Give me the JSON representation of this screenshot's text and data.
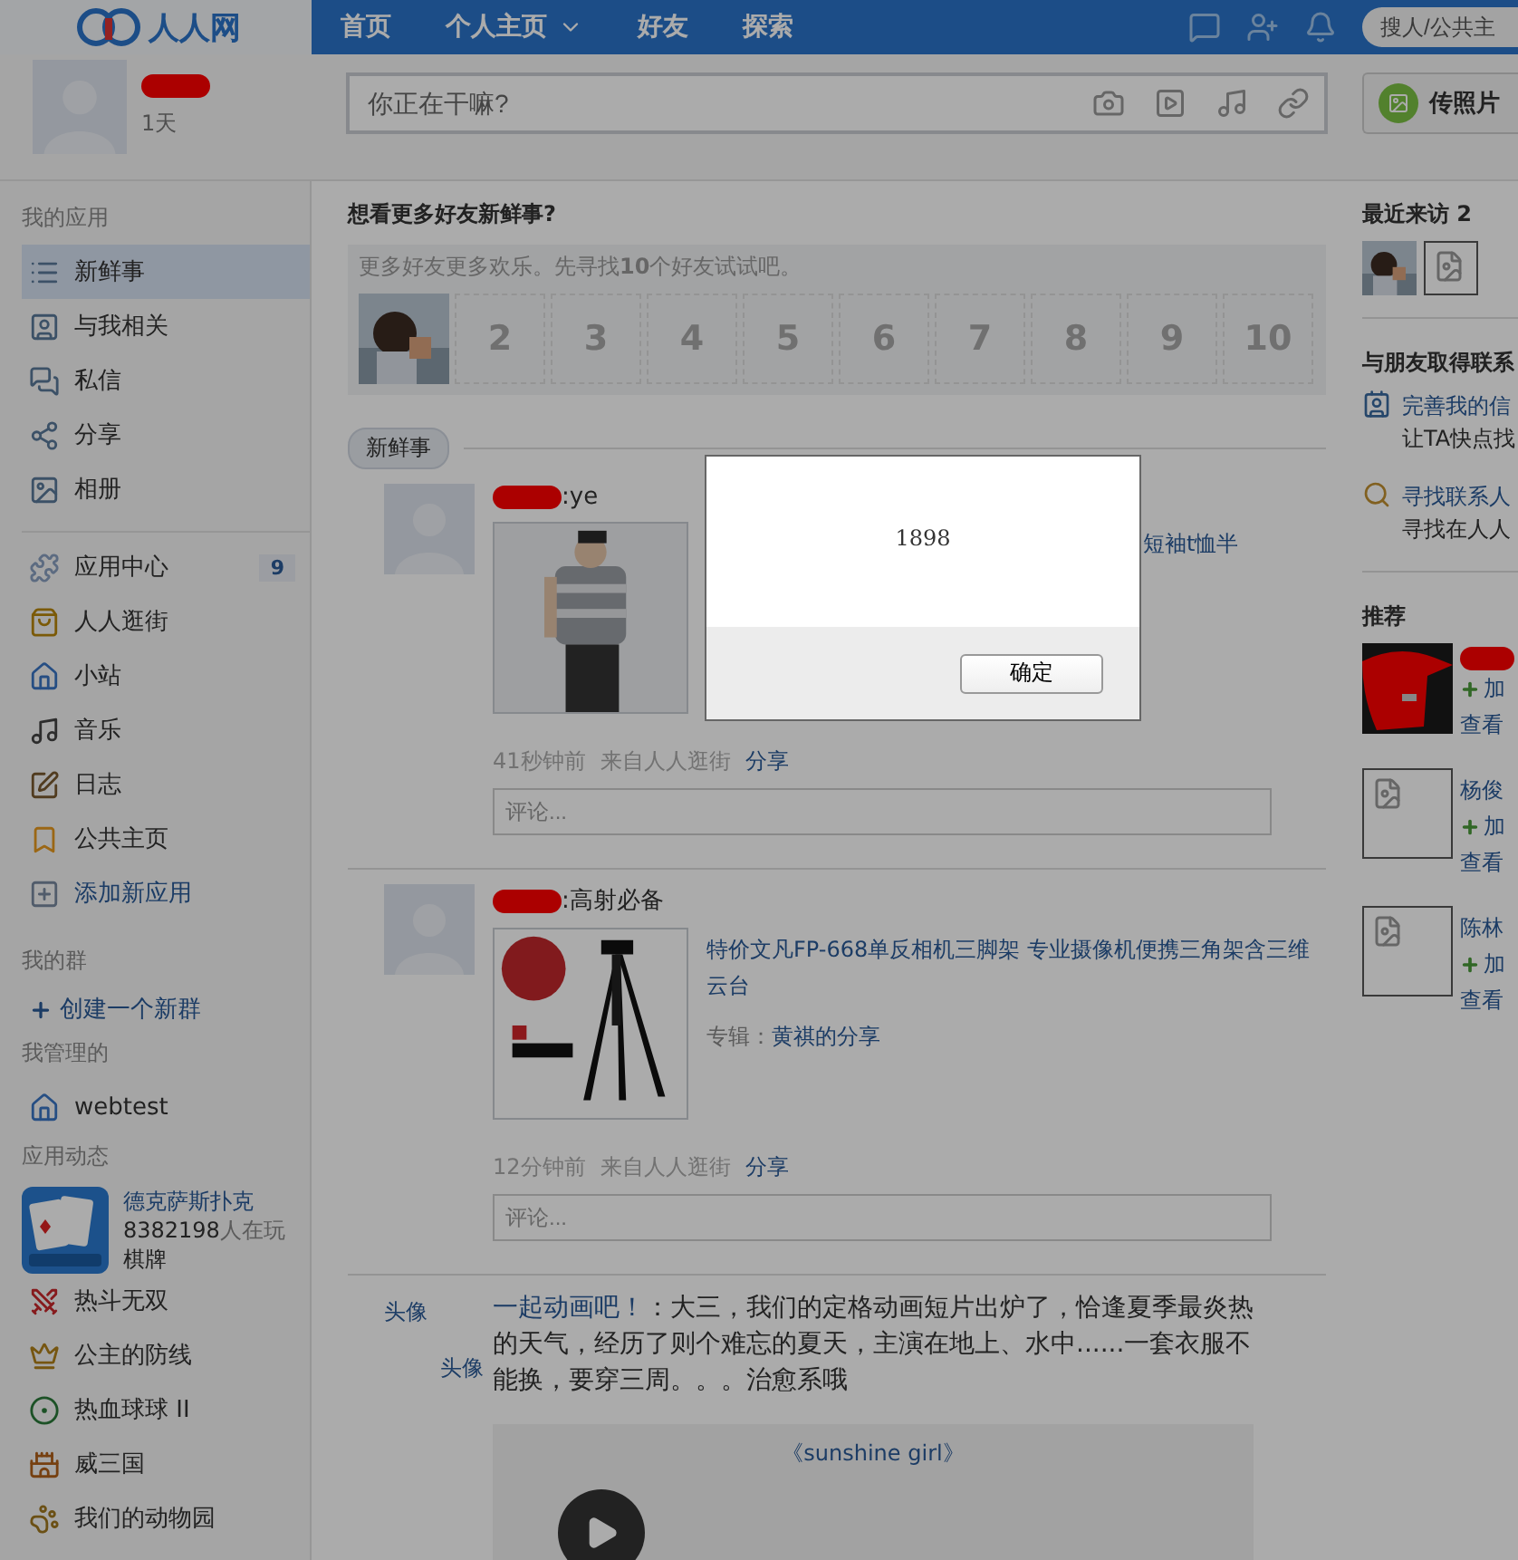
{
  "topbar": {
    "logo": "人人网",
    "nav": [
      {
        "label": "首页",
        "dropdown": false
      },
      {
        "label": "个人主页",
        "dropdown": true
      },
      {
        "label": "好友",
        "dropdown": false
      },
      {
        "label": "探索",
        "dropdown": false
      }
    ],
    "search": {
      "placeholder": "搜人/公共主"
    }
  },
  "profile": {
    "joined": "1天"
  },
  "composer": {
    "placeholder": "你正在干嘛?"
  },
  "upload_button": "传照片",
  "my_apps": {
    "heading": "我的应用",
    "items": [
      {
        "label": "新鲜事",
        "selected": true
      },
      {
        "label": "与我相关",
        "selected": false
      },
      {
        "label": "私信",
        "selected": false
      },
      {
        "label": "分享",
        "selected": false
      },
      {
        "label": "相册",
        "selected": false
      }
    ]
  },
  "apps": {
    "items": [
      {
        "label": "应用中心",
        "selected": false,
        "badge": "9"
      },
      {
        "label": "人人逛街",
        "selected": false
      },
      {
        "label": "小站",
        "selected": false
      },
      {
        "label": "音乐",
        "selected": false
      },
      {
        "label": "日志",
        "selected": false
      },
      {
        "label": "公共主页",
        "selected": false
      },
      {
        "label": "添加新应用",
        "selected": false,
        "kind": "link"
      }
    ]
  },
  "groups": {
    "heading": "我的群",
    "create": "创建一个新群",
    "managed_heading": "我管理的",
    "managed": [
      "webtest"
    ]
  },
  "app_feed": {
    "heading": "应用动态",
    "featured": {
      "name": "德克萨斯扑克",
      "players": "8382198",
      "players_label": "人在玩",
      "category": "棋牌"
    },
    "games": [
      "热斗无双",
      "公主的防线",
      "热血球球 II",
      "威三国",
      "我们的动物园"
    ]
  },
  "friends_prompt": {
    "title": "想看更多好友新鲜事?",
    "text": "更多好友更多欢乐。先寻找**10**个好友试试吧。",
    "slots": [
      "2",
      "3",
      "4",
      "5",
      "6",
      "7",
      "8",
      "9",
      "10"
    ]
  },
  "feed": {
    "tab": "新鲜事",
    "posts": [
      {
        "kind": "covered-share",
        "title": ":ye",
        "link": "短袖t恤半",
        "time": "41秒钟前",
        "source": "来自人人逛街",
        "action": "分享",
        "comment_placeholder": "评论..."
      },
      {
        "kind": "share",
        "title": ":高射必备",
        "link": "特价文凡FP-668单反相机三脚架 专业摄像机便携三角架含三维云台",
        "album_label": "专辑：",
        "album": "黄祺的分享",
        "time": "12分钟前",
        "source": "来自人人逛街",
        "action": "分享",
        "comment_placeholder": "评论..."
      },
      {
        "kind": "video",
        "avatar_alts": [
          "头像",
          "头像"
        ],
        "source_link": "一起动画吧！",
        "text": "：大三，我们的定格动画短片出炉了，恰逢夏季最炎热的天气，经历了则个难忘的夏天，主演在地上、水中......一套衣服不能换，要穿三周。。。治愈系哦",
        "video_title": "《sunshine girl》"
      }
    ]
  },
  "recent_visitors": {
    "title": "最近来访 2"
  },
  "contact": {
    "title": "与朋友取得联系",
    "items": [
      {
        "link": "完善我的信",
        "text": "让TA快点找"
      },
      {
        "link": "寻找联系人",
        "text": "寻找在人人"
      }
    ]
  },
  "recommend": {
    "title": "推荐",
    "people": [
      {
        "add": "加",
        "view": "查看"
      },
      {
        "name": "杨俊",
        "add": "加",
        "view": "查看"
      },
      {
        "name": "陈林",
        "add": "加",
        "view": "查看"
      }
    ]
  },
  "dialog": {
    "message": "1898",
    "button": "确定"
  }
}
